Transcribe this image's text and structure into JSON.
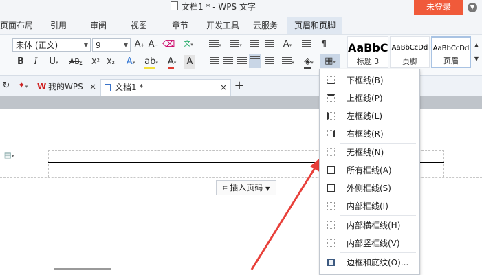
{
  "window": {
    "title": "文档1 * - WPS 文字",
    "login_button": "未登录"
  },
  "menu": {
    "tabs": [
      "页面布局",
      "引用",
      "审阅",
      "视图",
      "章节",
      "开发工具",
      "云服务",
      "页眉和页脚"
    ]
  },
  "ribbon": {
    "font_name": "宋体 (正文)",
    "font_size": "9",
    "styles": [
      {
        "sample": "AaBbC",
        "name": "标题 3"
      },
      {
        "sample": "AaBbCcDd",
        "name": "页脚"
      },
      {
        "sample": "AaBbCcDd",
        "name": "页眉"
      }
    ]
  },
  "doc_tabs": [
    {
      "label": "我的WPS",
      "close": "×"
    },
    {
      "label": "文档1 *",
      "close": "×"
    }
  ],
  "new_tab": "+",
  "document": {
    "insert_page_number": "插入页码"
  },
  "border_menu": {
    "items": [
      {
        "label": "下框线(B)",
        "icon": "border-bottom-icon"
      },
      {
        "label": "上框线(P)",
        "icon": "border-top-icon"
      },
      {
        "label": "左框线(L)",
        "icon": "border-left-icon"
      },
      {
        "label": "右框线(R)",
        "icon": "border-right-icon"
      },
      {
        "label": "无框线(N)",
        "icon": "border-none-icon"
      },
      {
        "label": "所有框线(A)",
        "icon": "border-all-icon"
      },
      {
        "label": "外侧框线(S)",
        "icon": "border-outside-icon"
      },
      {
        "label": "内部框线(I)",
        "icon": "border-inside-icon"
      },
      {
        "label": "内部横框线(H)",
        "icon": "border-inside-horizontal-icon"
      },
      {
        "label": "内部竖框线(V)",
        "icon": "border-inside-vertical-icon"
      },
      {
        "label": "边框和底纹(O)...",
        "icon": "borders-and-shading-icon"
      }
    ]
  },
  "colors": {
    "login": "#f05a3a",
    "annotation_arrow": "#e8403a",
    "active_tab": "#dfe7f1"
  }
}
